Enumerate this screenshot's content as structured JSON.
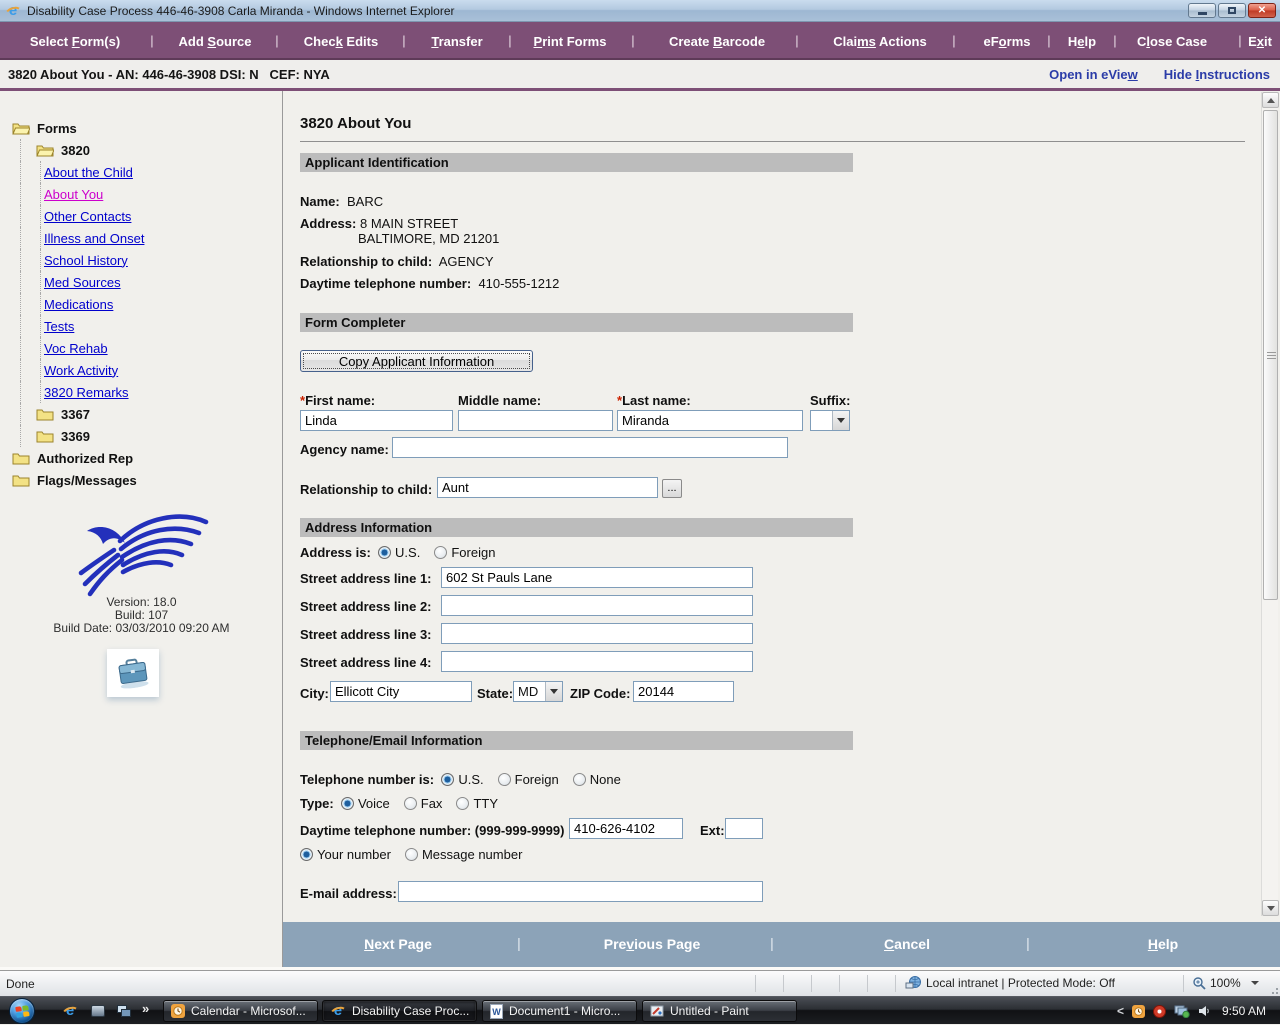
{
  "window": {
    "title": "Disability Case Process 446-46-3908 Carla Miranda - Windows Internet Explorer"
  },
  "menu": {
    "separator": "|",
    "items": [
      {
        "pre": "Select ",
        "key": "F",
        "post": "orm(s)"
      },
      {
        "pre": "Add ",
        "key": "S",
        "post": "ource"
      },
      {
        "pre": "Chec",
        "key": "k",
        "post": " Edits"
      },
      {
        "pre": "",
        "key": "T",
        "post": "ransfer"
      },
      {
        "pre": "",
        "key": "P",
        "post": "rint Forms"
      },
      {
        "pre": "Create ",
        "key": "B",
        "post": "arcode"
      },
      {
        "pre": "Clai",
        "key": "ms",
        "post": " Actions"
      },
      {
        "pre": "eF",
        "key": "o",
        "post": "rms"
      },
      {
        "pre": "H",
        "key": "e",
        "post": "lp"
      },
      {
        "pre": "C",
        "key": "l",
        "post": "ose Case"
      },
      {
        "pre": "E",
        "key": "x",
        "post": "it"
      }
    ]
  },
  "header": {
    "text": "3820 About You - AN: 446-46-3908 DSI: N   CEF: NYA",
    "eview": {
      "pre": "Open in eVie",
      "key": "w",
      "post": ""
    },
    "instructions": {
      "pre": "Hide ",
      "key": "I",
      "post": "nstructions"
    }
  },
  "sidebar": {
    "tree": [
      {
        "label": "Forms"
      },
      {
        "label": "3820"
      },
      {
        "label": "About the Child"
      },
      {
        "label": "About You"
      },
      {
        "label": "Other Contacts"
      },
      {
        "label": "Illness and Onset"
      },
      {
        "label": "School History"
      },
      {
        "label": "Med Sources"
      },
      {
        "label": "Medications"
      },
      {
        "label": "Tests"
      },
      {
        "label": "Voc Rehab"
      },
      {
        "label": "Work Activity"
      },
      {
        "label": "3820 Remarks"
      },
      {
        "label": "3367"
      },
      {
        "label": "3369"
      },
      {
        "label": "Authorized Rep"
      },
      {
        "label": "Flags/Messages"
      }
    ],
    "version1": "Version: 18.0",
    "version2": "Build: 107",
    "version3": "Build Date: 03/03/2010 09:20 AM"
  },
  "main": {
    "title": "3820 About You",
    "applicant": {
      "heading": "Applicant Identification",
      "name_label": "Name:",
      "name": "BARC",
      "address_label": "Address:",
      "address1": "8 MAIN STREET",
      "address2": "BALTIMORE, MD 21201",
      "rel_label": "Relationship to child:",
      "rel": "AGENCY",
      "phone_label": "Daytime telephone number:",
      "phone": "410-555-1212"
    },
    "completer": {
      "heading": "Form Completer",
      "copy_button": "Copy Applicant Information",
      "required_mark": "*",
      "first_label": "First name:",
      "first_value": "Linda",
      "middle_label": "Middle name:",
      "middle_value": "",
      "last_label": "Last name:",
      "last_value": "Miranda",
      "suffix_label": "Suffix:",
      "suffix_value": "",
      "agency_label": "Agency name:",
      "agency_value": "",
      "rel_label": "Relationship to child:",
      "rel_value": "Aunt",
      "browse_button": "..."
    },
    "address": {
      "heading": "Address Information",
      "address_is_label": "Address is:",
      "us": "U.S.",
      "foreign": "Foreign",
      "line1_label": "Street address line 1:",
      "line1_value": "602 St Pauls Lane",
      "line2_label": "Street address line 2:",
      "line2_value": "",
      "line3_label": "Street address line 3:",
      "line3_value": "",
      "line4_label": "Street address line 4:",
      "line4_value": "",
      "city_label": "City:",
      "city_value": "Ellicott City",
      "state_label": "State:",
      "state_value": "MD",
      "zip_label": "ZIP Code:",
      "zip_value": "20144"
    },
    "telephone": {
      "heading": "Telephone/Email Information",
      "number_is_label": "Telephone number is:",
      "us": "U.S.",
      "foreign": "Foreign",
      "none": "None",
      "type_label": "Type:",
      "voice": "Voice",
      "fax": "Fax",
      "tty": "TTY",
      "daytime_label": "Daytime telephone number: (999-999-9999)",
      "daytime_value": "410-626-4102",
      "ext_label": "Ext:",
      "ext_value": "",
      "your_number": "Your number",
      "message_number": "Message number",
      "email_label": "E-mail address:",
      "email_value": ""
    }
  },
  "footer": {
    "separator": "|",
    "items": [
      {
        "pre": "",
        "key": "N",
        "post": "ext Page"
      },
      {
        "pre": "Pre",
        "key": "v",
        "post": "ious Page"
      },
      {
        "pre": "",
        "key": "C",
        "post": "ancel"
      },
      {
        "pre": "",
        "key": "H",
        "post": "elp"
      }
    ]
  },
  "statusbar": {
    "done": "Done",
    "zone": "Local intranet | Protected Mode: Off",
    "zoom": "100%"
  },
  "taskbar": {
    "overflow": "»",
    "buttons": [
      {
        "label": "Calendar - Microsof..."
      },
      {
        "label": "Disability Case Proc..."
      },
      {
        "label": "Document1 - Micro..."
      },
      {
        "label": "Untitled - Paint"
      }
    ],
    "tray_chevron": "<",
    "time": "9:50 AM"
  }
}
